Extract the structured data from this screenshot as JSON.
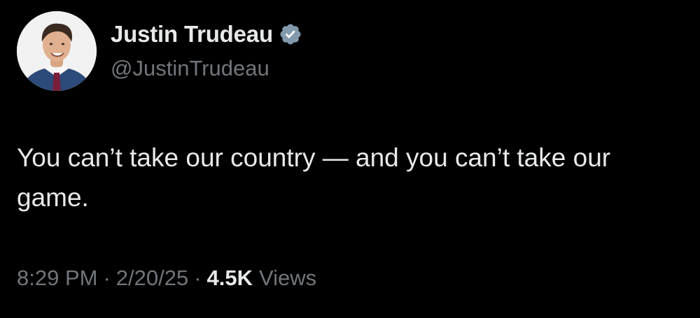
{
  "author": {
    "display_name": "Justin Trudeau",
    "handle": "@JustinTrudeau",
    "verified_icon": "verified-badge-icon",
    "badge_color": "#829aab"
  },
  "tweet": {
    "text": "You can’t take our country — and you can’t take our game."
  },
  "meta": {
    "time": "8:29 PM",
    "separator": "·",
    "date": "2/20/25",
    "views_count": "4.5K",
    "views_label": "Views"
  },
  "colors": {
    "background": "#000000",
    "primary_text": "#e7e9ea",
    "secondary_text": "#71767b"
  }
}
